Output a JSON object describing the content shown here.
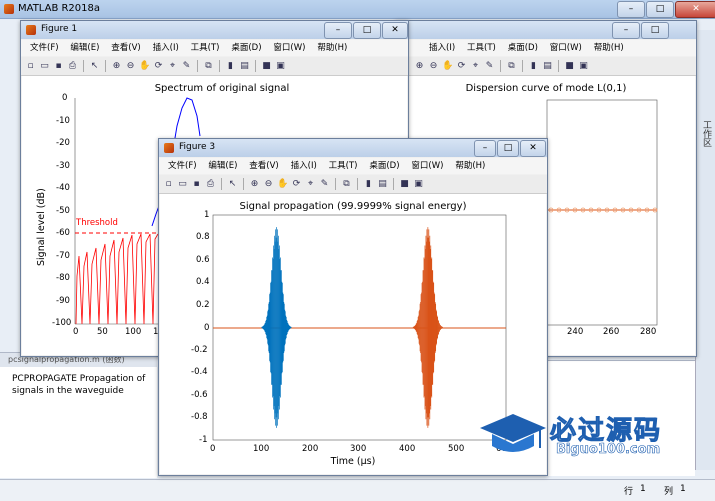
{
  "main_window": {
    "title": "MATLAB R2018a",
    "right_tab": "工作区"
  },
  "help_panel": {
    "header": "pcsignalpropagation.m  (函数)",
    "text": "PCPROPAGATE   Propagation of signals in the waveguide"
  },
  "statusbar": {
    "row_label": "行",
    "row_value": "1",
    "col_label": "列",
    "col_value": "1"
  },
  "menus": [
    "文件(F)",
    "编辑(E)",
    "查看(V)",
    "插入(I)",
    "工具(T)",
    "桌面(D)",
    "窗口(W)",
    "帮助(H)"
  ],
  "figure1": {
    "title": "Figure 1",
    "plot_title": "Spectrum of original signal",
    "ylabel": "Signal level (dB)",
    "threshold_label": "Threshold",
    "threshold_value": -60,
    "yticks": [
      "0",
      "-10",
      "-20",
      "-30",
      "-40",
      "-50",
      "-60",
      "-70",
      "-80",
      "-90",
      "-100"
    ],
    "xticks": [
      "0",
      "50",
      "100",
      "1"
    ]
  },
  "figure2": {
    "plot_title": "Dispersion curve of mode L(0,1)",
    "xticks": [
      "240",
      "260",
      "280"
    ]
  },
  "figure3": {
    "title": "Figure 3",
    "plot_title": "Signal propagation (99.9999% signal energy)",
    "xlabel": "Time (μs)",
    "yticks": [
      "1",
      "0.8",
      "0.6",
      "0.4",
      "0.2",
      "0",
      "-0.2",
      "-0.4",
      "-0.6",
      "-0.8",
      "-1"
    ],
    "xticks": [
      "0",
      "100",
      "200",
      "300",
      "400",
      "500",
      "600"
    ]
  },
  "watermark": {
    "main": "必过源码",
    "sub": "Biguo100.com"
  },
  "colors": {
    "signal1": "#0072bd",
    "signal2": "#d95319",
    "threshold": "#ff0000",
    "spectrum_curve": "#0000ff"
  },
  "chart_data": [
    {
      "type": "line",
      "title": "Spectrum of original signal",
      "ylabel": "Signal level (dB)",
      "ylim": [
        -100,
        0
      ],
      "series": [
        {
          "name": "Threshold",
          "values": [
            -60,
            -60
          ]
        }
      ]
    },
    {
      "type": "line",
      "title": "Signal propagation (99.9999% signal energy)",
      "xlabel": "Time (μs)",
      "ylim": [
        -1,
        1
      ],
      "xlim": [
        0,
        600
      ],
      "series": [
        {
          "x": [
            100,
            130,
            160
          ],
          "values": [
            0,
            0.85,
            0
          ]
        },
        {
          "x": [
            410,
            440,
            470
          ],
          "values": [
            0,
            0.85,
            0
          ]
        }
      ]
    }
  ]
}
